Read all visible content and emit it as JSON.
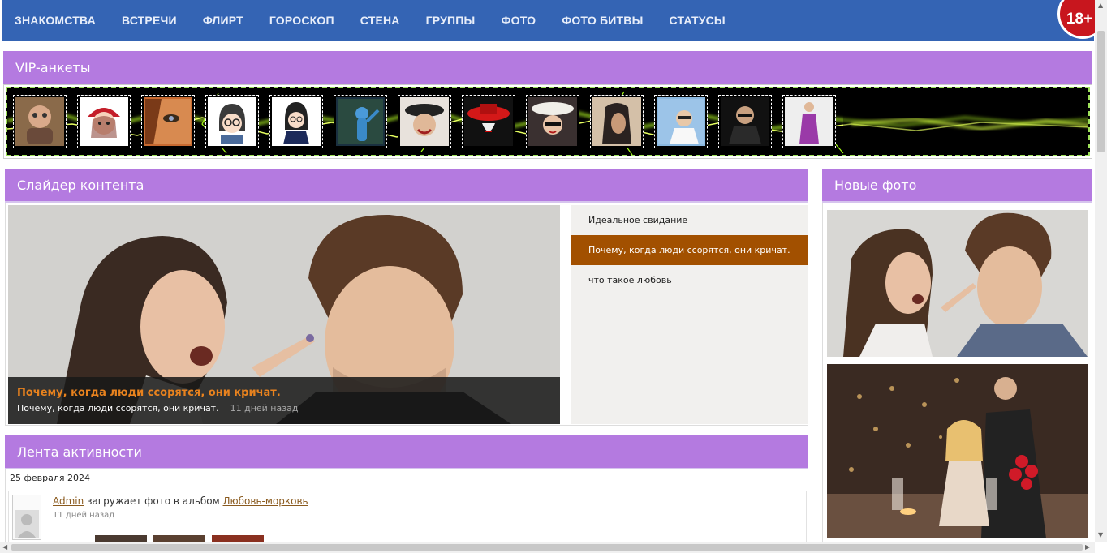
{
  "nav": {
    "items": [
      "ЗНАКОМСТВА",
      "ВСТРЕЧИ",
      "ФЛИРТ",
      "ГОРОСКОП",
      "СТЕНА",
      "ГРУППЫ",
      "ФОТО",
      "ФОТО БИТВЫ",
      "СТАТУСЫ"
    ],
    "age_badge": "18+"
  },
  "vip": {
    "title": "VIP-анкеты",
    "thumbs": [
      "avatar-1",
      "avatar-2",
      "avatar-3",
      "avatar-4",
      "avatar-5",
      "avatar-6",
      "avatar-7",
      "avatar-8",
      "avatar-9",
      "avatar-10",
      "avatar-11",
      "avatar-12",
      "avatar-13"
    ]
  },
  "slider": {
    "title": "Слайдер контента",
    "caption_title": "Почему, когда люди ссорятся, они кричат.",
    "caption_text": "Почему, когда люди ссорятся, они кричат.",
    "caption_ago": "11 дней назад",
    "items": [
      "Идеальное свидание",
      "Почему, когда люди ссорятся, они кричат.",
      "что такое любовь"
    ],
    "active_index": 1
  },
  "photos": {
    "title": "Новые фото"
  },
  "activity": {
    "title": "Лента активности",
    "date": "25 февраля 2024",
    "user": "Admin",
    "action": " загружает фото в альбом ",
    "album": "Любовь-морковь",
    "ago": "11 дней назад"
  },
  "colors": {
    "nav_bg": "#3464b4",
    "header_bg": "#b47ae0",
    "active_item": "#a25000",
    "caption_title": "#e8821e"
  }
}
